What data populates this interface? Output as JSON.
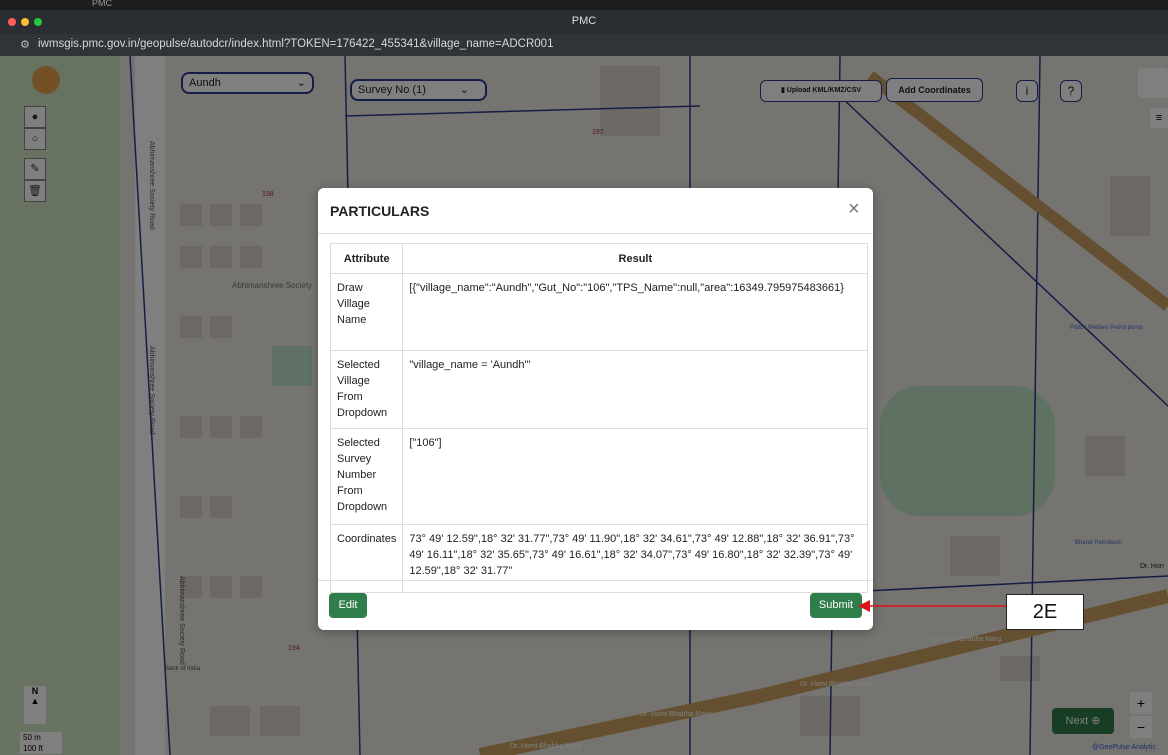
{
  "browser": {
    "tab_title": "PMC",
    "window_title": "PMC",
    "url": "iwmsgis.pmc.gov.in/geopulse/autodcr/index.html?TOKEN=176422_455341&village_name=ADCR001"
  },
  "toolbar": {
    "village_select": "Aundh",
    "survey_select": "Survey No (1)",
    "upload_label": "Upload KML/KMZ/CSV",
    "add_coordinates_label": "Add Coordinates",
    "info_label": "i",
    "help_label": "?"
  },
  "map_labels": {
    "society1": "Abhimanshree Society",
    "road1": "Abhimanshree Society Road",
    "road2": "Abhimanshree Society Road",
    "road3": "Abhimanshree Society Road",
    "marg1": "Dr. Homi Bhabha Marg",
    "marg2": "Dr. Homi Bhabha Marg",
    "marg3": "Dr. Homi Bhabha Marg",
    "marg4": "Dr. Homi Bhabha Marg",
    "petrol1": "Police Welfare Petrol pump",
    "petrol2": "Bharat Petroleum",
    "bank": "Bank of India",
    "plot1": "197",
    "plot2": "198",
    "plot3": "194",
    "right_edge": "Dr. Hon"
  },
  "scale": {
    "metric": "50 m",
    "imperial": "100 ft",
    "north": "N"
  },
  "next_button": "Next",
  "zoom": {
    "in": "+",
    "out": "−"
  },
  "attribution": "@GeoPulse Analytic",
  "modal": {
    "title": "PARTICULARS",
    "close": "×",
    "headers": {
      "attribute": "Attribute",
      "result": "Result"
    },
    "rows": [
      {
        "attribute": "Draw Village Name",
        "result": "[{\"village_name\":\"Aundh\",\"Gut_No\":\"106\",\"TPS_Name\":null,\"area\":16349.795975483661}"
      },
      {
        "attribute": "Selected Village From Dropdown",
        "result": "\"village_name = 'Aundh'\""
      },
      {
        "attribute": "Selected Survey Number From Dropdown",
        "result": "[\"106\"]"
      },
      {
        "attribute": "Coordinates",
        "result": "73° 49' 12.59\",18° 32' 31.77\",73° 49' 11.90\",18° 32' 34.61\",73° 49' 12.88\",18° 32' 36.91\",73° 49' 16.11\",18° 32' 35.65\",73° 49' 16.61\",18° 32' 34.07\",73° 49' 16.80\",18° 32' 32.39\",73° 49' 12.59\",18° 32' 31.77\""
      }
    ],
    "edit_label": "Edit",
    "submit_label": "Submit"
  },
  "annotation": {
    "label": "2E",
    "color": "#e0101a"
  },
  "colors": {
    "accent": "#2e7d4a",
    "parcel_line": "#2b3a8c"
  }
}
